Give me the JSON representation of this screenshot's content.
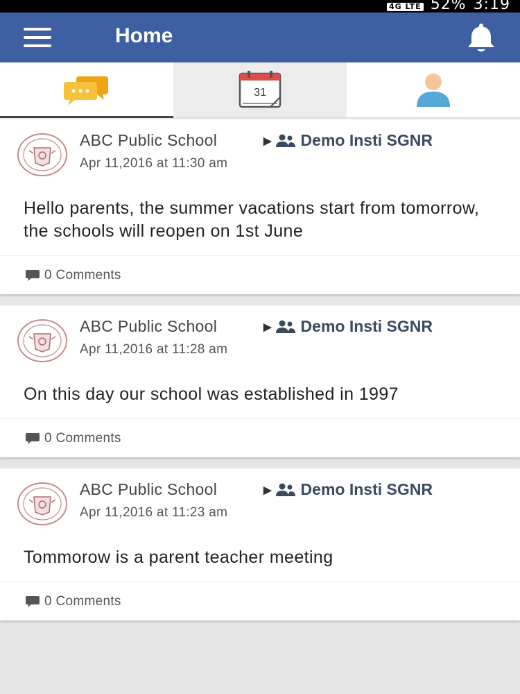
{
  "status": {
    "network": "4G LTE",
    "battery": "52%",
    "time": "3:19"
  },
  "app_bar": {
    "title": "Home"
  },
  "tabs": [
    {
      "name": "messages",
      "icon": "chat-bubbles-icon",
      "active": true
    },
    {
      "name": "calendar",
      "icon": "calendar-icon",
      "date": "31"
    },
    {
      "name": "profile",
      "icon": "user-icon"
    }
  ],
  "posts": [
    {
      "school": "ABC Public School",
      "group": "Demo Insti SGNR",
      "timestamp": "Apr 11,2016 at 11:30 am",
      "text": "Hello parents, the summer vacations start from tomorrow, the schools will reopen on 1st June",
      "comments": "0 Comments"
    },
    {
      "school": "ABC Public School",
      "group": "Demo Insti SGNR",
      "timestamp": "Apr 11,2016 at 11:28 am",
      "text": "On this day our school was established in 1997",
      "comments": "0 Comments"
    },
    {
      "school": "ABC Public School",
      "group": "Demo Insti SGNR",
      "timestamp": "Apr 11,2016 at 11:23 am",
      "text": "Tommorow is a parent teacher meeting",
      "comments": "0 Comments"
    }
  ],
  "colors": {
    "app_bar": "#3f5fa3",
    "chat_icon": "#f5b324",
    "calendar_accent": "#e04b4b",
    "avatar_body": "#55a8d8",
    "avatar_head": "#f4c79a"
  }
}
